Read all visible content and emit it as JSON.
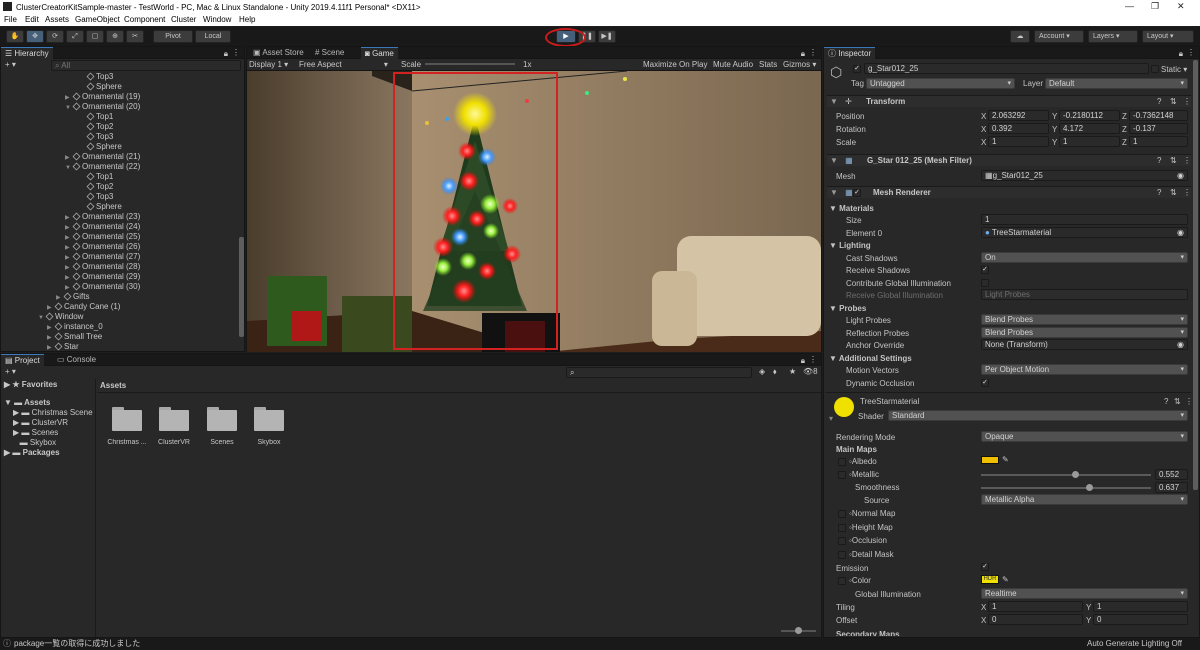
{
  "window": {
    "title": "ClusterCreatorKitSample-master - TestWorld - PC, Mac & Linux Standalone - Unity 2019.4.11f1 Personal* <DX11>"
  },
  "menu": [
    "File",
    "Edit",
    "Assets",
    "GameObject",
    "Component",
    "Cluster",
    "Window",
    "Help"
  ],
  "toolbar": {
    "pivot": "Pivot",
    "local": "Local",
    "account": "Account",
    "layers": "Layers",
    "layout": "Layout"
  },
  "hierarchy": {
    "tab": "Hierarchy",
    "search_placeholder": "All",
    "rows": [
      {
        "label": "Top3",
        "indent": 88,
        "arrow": ""
      },
      {
        "label": "Sphere",
        "indent": 88,
        "arrow": ""
      },
      {
        "label": "Ornamental (19)",
        "indent": 74,
        "arrow": "▶"
      },
      {
        "label": "Ornamental (20)",
        "indent": 74,
        "arrow": "▼"
      },
      {
        "label": "Top1",
        "indent": 88,
        "arrow": ""
      },
      {
        "label": "Top2",
        "indent": 88,
        "arrow": ""
      },
      {
        "label": "Top3",
        "indent": 88,
        "arrow": ""
      },
      {
        "label": "Sphere",
        "indent": 88,
        "arrow": ""
      },
      {
        "label": "Ornamental (21)",
        "indent": 74,
        "arrow": "▶"
      },
      {
        "label": "Ornamental (22)",
        "indent": 74,
        "arrow": "▼"
      },
      {
        "label": "Top1",
        "indent": 88,
        "arrow": ""
      },
      {
        "label": "Top2",
        "indent": 88,
        "arrow": ""
      },
      {
        "label": "Top3",
        "indent": 88,
        "arrow": ""
      },
      {
        "label": "Sphere",
        "indent": 88,
        "arrow": ""
      },
      {
        "label": "Ornamental (23)",
        "indent": 74,
        "arrow": "▶"
      },
      {
        "label": "Ornamental (24)",
        "indent": 74,
        "arrow": "▶"
      },
      {
        "label": "Ornamental (25)",
        "indent": 74,
        "arrow": "▶"
      },
      {
        "label": "Ornamental (26)",
        "indent": 74,
        "arrow": "▶"
      },
      {
        "label": "Ornamental (27)",
        "indent": 74,
        "arrow": "▶"
      },
      {
        "label": "Ornamental (28)",
        "indent": 74,
        "arrow": "▶"
      },
      {
        "label": "Ornamental (29)",
        "indent": 74,
        "arrow": "▶"
      },
      {
        "label": "Ornamental (30)",
        "indent": 74,
        "arrow": "▶"
      },
      {
        "label": "Gifts",
        "indent": 65,
        "arrow": "▶"
      },
      {
        "label": "Candy Cane (1)",
        "indent": 56,
        "arrow": "▶"
      },
      {
        "label": "Window",
        "indent": 47,
        "arrow": "▼"
      },
      {
        "label": "instance_0",
        "indent": 56,
        "arrow": "▶"
      },
      {
        "label": "Small Tree",
        "indent": 56,
        "arrow": "▶"
      },
      {
        "label": "Star",
        "indent": 56,
        "arrow": "▶"
      }
    ]
  },
  "scene": {
    "tabs": [
      "Asset Store",
      "Scene",
      "Game"
    ],
    "display": "Display 1",
    "aspect": "Free Aspect",
    "scale_label": "Scale",
    "scale_value": "1x",
    "options": [
      "Maximize On Play",
      "Mute Audio",
      "Stats",
      "Gizmos"
    ]
  },
  "project": {
    "tabs": [
      "Project",
      "Console"
    ],
    "favorites": "Favorites",
    "tree": [
      "Assets",
      "Christmas Scene",
      "ClusterVR",
      "Scenes",
      "Skybox",
      "Packages"
    ],
    "breadcrumb": "Assets",
    "folders": [
      "Christmas ...",
      "ClusterVR",
      "Scenes",
      "Skybox"
    ],
    "badge": "8"
  },
  "inspector": {
    "tab": "Inspector",
    "object_name": "g_Star012_25",
    "static": "Static",
    "tag_label": "Tag",
    "tag": "Untagged",
    "layer_label": "Layer",
    "layer": "Default",
    "transform": {
      "title": "Transform",
      "rows": [
        {
          "label": "Position",
          "x": "2.063292",
          "y": "-0.2180112",
          "z": "-0.7362148"
        },
        {
          "label": "Rotation",
          "x": "0.392",
          "y": "4.172",
          "z": "-0.137"
        },
        {
          "label": "Scale",
          "x": "1",
          "y": "1",
          "z": "1"
        }
      ]
    },
    "mesh_filter": {
      "title": "G_Star 012_25 (Mesh Filter)",
      "mesh_label": "Mesh",
      "mesh": "g_Star012_25"
    },
    "mesh_renderer": {
      "title": "Mesh Renderer",
      "materials": "Materials",
      "size_label": "Size",
      "size": "1",
      "element_label": "Element 0",
      "element": "TreeStarmaterial",
      "lighting": "Lighting",
      "cast_label": "Cast Shadows",
      "cast": "On",
      "receive_label": "Receive Shadows",
      "contribute_label": "Contribute Global Illumination",
      "receive_gi_label": "Receive Global Illumination",
      "receive_gi": "Light Probes",
      "probes": "Probes",
      "light_probes_label": "Light Probes",
      "light_probes": "Blend Probes",
      "reflection_label": "Reflection Probes",
      "reflection": "Blend Probes",
      "anchor_label": "Anchor Override",
      "anchor": "None (Transform)",
      "additional": "Additional Settings",
      "motion_label": "Motion Vectors",
      "motion": "Per Object Motion",
      "dynamic_label": "Dynamic Occlusion"
    },
    "material": {
      "name": "TreeStarmaterial",
      "shader_label": "Shader",
      "shader": "Standard",
      "rendering_label": "Rendering Mode",
      "rendering": "Opaque",
      "main_maps": "Main Maps",
      "albedo": "Albedo",
      "metallic": "Metallic",
      "metallic_value": "0.552",
      "metallic_level": 0.552,
      "smoothness": "Smoothness",
      "smoothness_value": "0.637",
      "smoothness_level": 0.637,
      "source_label": "Source",
      "source": "Metallic Alpha",
      "normal": "Normal Map",
      "height": "Height Map",
      "occlusion": "Occlusion",
      "detail": "Detail Mask",
      "emission": "Emission",
      "color": "Color",
      "hdr": "HDR",
      "gi_label": "Global Illumination",
      "gi": "Realtime",
      "tiling_label": "Tiling",
      "tiling_x": "1",
      "tiling_y": "1",
      "offset_label": "Offset",
      "offset_x": "0",
      "offset_y": "0",
      "secondary": "Secondary Maps"
    }
  },
  "status": {
    "message": "package一覧の取得に成功しました",
    "right": "Auto Generate Lighting Off"
  },
  "colors": {
    "accent": "#3a79bb",
    "highlight_rect": "#d22222",
    "circle": "#c81c1c",
    "albedo": "#f0c000",
    "hdr": "#f0e000"
  }
}
